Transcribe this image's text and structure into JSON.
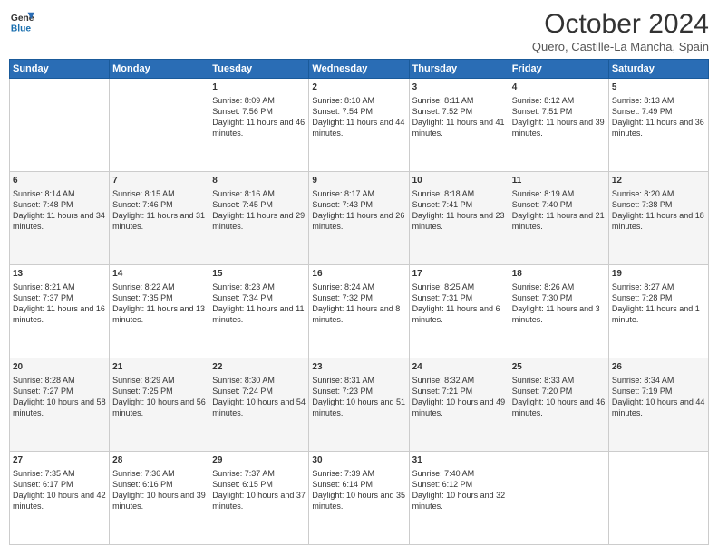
{
  "logo": {
    "line1": "General",
    "line2": "Blue"
  },
  "header": {
    "title": "October 2024",
    "location": "Quero, Castille-La Mancha, Spain"
  },
  "days_of_week": [
    "Sunday",
    "Monday",
    "Tuesday",
    "Wednesday",
    "Thursday",
    "Friday",
    "Saturday"
  ],
  "weeks": [
    [
      {
        "day": "",
        "sunrise": "",
        "sunset": "",
        "daylight": ""
      },
      {
        "day": "",
        "sunrise": "",
        "sunset": "",
        "daylight": ""
      },
      {
        "day": "1",
        "sunrise": "Sunrise: 8:09 AM",
        "sunset": "Sunset: 7:56 PM",
        "daylight": "Daylight: 11 hours and 46 minutes."
      },
      {
        "day": "2",
        "sunrise": "Sunrise: 8:10 AM",
        "sunset": "Sunset: 7:54 PM",
        "daylight": "Daylight: 11 hours and 44 minutes."
      },
      {
        "day": "3",
        "sunrise": "Sunrise: 8:11 AM",
        "sunset": "Sunset: 7:52 PM",
        "daylight": "Daylight: 11 hours and 41 minutes."
      },
      {
        "day": "4",
        "sunrise": "Sunrise: 8:12 AM",
        "sunset": "Sunset: 7:51 PM",
        "daylight": "Daylight: 11 hours and 39 minutes."
      },
      {
        "day": "5",
        "sunrise": "Sunrise: 8:13 AM",
        "sunset": "Sunset: 7:49 PM",
        "daylight": "Daylight: 11 hours and 36 minutes."
      }
    ],
    [
      {
        "day": "6",
        "sunrise": "Sunrise: 8:14 AM",
        "sunset": "Sunset: 7:48 PM",
        "daylight": "Daylight: 11 hours and 34 minutes."
      },
      {
        "day": "7",
        "sunrise": "Sunrise: 8:15 AM",
        "sunset": "Sunset: 7:46 PM",
        "daylight": "Daylight: 11 hours and 31 minutes."
      },
      {
        "day": "8",
        "sunrise": "Sunrise: 8:16 AM",
        "sunset": "Sunset: 7:45 PM",
        "daylight": "Daylight: 11 hours and 29 minutes."
      },
      {
        "day": "9",
        "sunrise": "Sunrise: 8:17 AM",
        "sunset": "Sunset: 7:43 PM",
        "daylight": "Daylight: 11 hours and 26 minutes."
      },
      {
        "day": "10",
        "sunrise": "Sunrise: 8:18 AM",
        "sunset": "Sunset: 7:41 PM",
        "daylight": "Daylight: 11 hours and 23 minutes."
      },
      {
        "day": "11",
        "sunrise": "Sunrise: 8:19 AM",
        "sunset": "Sunset: 7:40 PM",
        "daylight": "Daylight: 11 hours and 21 minutes."
      },
      {
        "day": "12",
        "sunrise": "Sunrise: 8:20 AM",
        "sunset": "Sunset: 7:38 PM",
        "daylight": "Daylight: 11 hours and 18 minutes."
      }
    ],
    [
      {
        "day": "13",
        "sunrise": "Sunrise: 8:21 AM",
        "sunset": "Sunset: 7:37 PM",
        "daylight": "Daylight: 11 hours and 16 minutes."
      },
      {
        "day": "14",
        "sunrise": "Sunrise: 8:22 AM",
        "sunset": "Sunset: 7:35 PM",
        "daylight": "Daylight: 11 hours and 13 minutes."
      },
      {
        "day": "15",
        "sunrise": "Sunrise: 8:23 AM",
        "sunset": "Sunset: 7:34 PM",
        "daylight": "Daylight: 11 hours and 11 minutes."
      },
      {
        "day": "16",
        "sunrise": "Sunrise: 8:24 AM",
        "sunset": "Sunset: 7:32 PM",
        "daylight": "Daylight: 11 hours and 8 minutes."
      },
      {
        "day": "17",
        "sunrise": "Sunrise: 8:25 AM",
        "sunset": "Sunset: 7:31 PM",
        "daylight": "Daylight: 11 hours and 6 minutes."
      },
      {
        "day": "18",
        "sunrise": "Sunrise: 8:26 AM",
        "sunset": "Sunset: 7:30 PM",
        "daylight": "Daylight: 11 hours and 3 minutes."
      },
      {
        "day": "19",
        "sunrise": "Sunrise: 8:27 AM",
        "sunset": "Sunset: 7:28 PM",
        "daylight": "Daylight: 11 hours and 1 minute."
      }
    ],
    [
      {
        "day": "20",
        "sunrise": "Sunrise: 8:28 AM",
        "sunset": "Sunset: 7:27 PM",
        "daylight": "Daylight: 10 hours and 58 minutes."
      },
      {
        "day": "21",
        "sunrise": "Sunrise: 8:29 AM",
        "sunset": "Sunset: 7:25 PM",
        "daylight": "Daylight: 10 hours and 56 minutes."
      },
      {
        "day": "22",
        "sunrise": "Sunrise: 8:30 AM",
        "sunset": "Sunset: 7:24 PM",
        "daylight": "Daylight: 10 hours and 54 minutes."
      },
      {
        "day": "23",
        "sunrise": "Sunrise: 8:31 AM",
        "sunset": "Sunset: 7:23 PM",
        "daylight": "Daylight: 10 hours and 51 minutes."
      },
      {
        "day": "24",
        "sunrise": "Sunrise: 8:32 AM",
        "sunset": "Sunset: 7:21 PM",
        "daylight": "Daylight: 10 hours and 49 minutes."
      },
      {
        "day": "25",
        "sunrise": "Sunrise: 8:33 AM",
        "sunset": "Sunset: 7:20 PM",
        "daylight": "Daylight: 10 hours and 46 minutes."
      },
      {
        "day": "26",
        "sunrise": "Sunrise: 8:34 AM",
        "sunset": "Sunset: 7:19 PM",
        "daylight": "Daylight: 10 hours and 44 minutes."
      }
    ],
    [
      {
        "day": "27",
        "sunrise": "Sunrise: 7:35 AM",
        "sunset": "Sunset: 6:17 PM",
        "daylight": "Daylight: 10 hours and 42 minutes."
      },
      {
        "day": "28",
        "sunrise": "Sunrise: 7:36 AM",
        "sunset": "Sunset: 6:16 PM",
        "daylight": "Daylight: 10 hours and 39 minutes."
      },
      {
        "day": "29",
        "sunrise": "Sunrise: 7:37 AM",
        "sunset": "Sunset: 6:15 PM",
        "daylight": "Daylight: 10 hours and 37 minutes."
      },
      {
        "day": "30",
        "sunrise": "Sunrise: 7:39 AM",
        "sunset": "Sunset: 6:14 PM",
        "daylight": "Daylight: 10 hours and 35 minutes."
      },
      {
        "day": "31",
        "sunrise": "Sunrise: 7:40 AM",
        "sunset": "Sunset: 6:12 PM",
        "daylight": "Daylight: 10 hours and 32 minutes."
      },
      {
        "day": "",
        "sunrise": "",
        "sunset": "",
        "daylight": ""
      },
      {
        "day": "",
        "sunrise": "",
        "sunset": "",
        "daylight": ""
      }
    ]
  ]
}
